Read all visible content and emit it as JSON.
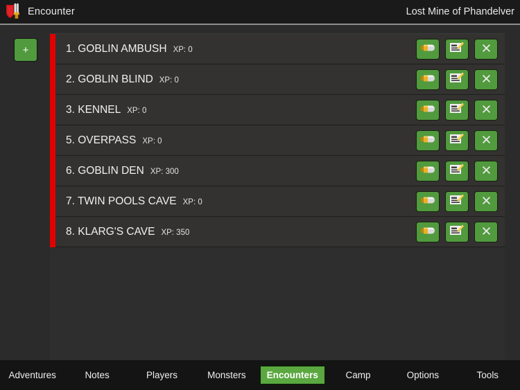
{
  "titlebar": {
    "icon": "shield-sword-icon",
    "app_title": "Encounter",
    "adventure_title": "Lost Mine of Phandelver"
  },
  "toolbar": {
    "add_label": "+",
    "add_icon": "plus-icon"
  },
  "encounters": {
    "xp_prefix": "XP: ",
    "rows": [
      {
        "name": "1. GOBLIN AMBUSH",
        "xp": "XP: 0"
      },
      {
        "name": "2. GOBLIN BLIND",
        "xp": "XP: 0"
      },
      {
        "name": "3. KENNEL",
        "xp": "XP: 0"
      },
      {
        "name": "5. OVERPASS",
        "xp": "XP: 0"
      },
      {
        "name": "6. GOBLIN DEN",
        "xp": "XP: 300"
      },
      {
        "name": "7. TWIN POOLS CAVE",
        "xp": "XP: 0"
      },
      {
        "name": "8. KLARG'S CAVE",
        "xp": "XP: 350"
      }
    ],
    "actions": {
      "run_icon": "bullet-icon",
      "edit_icon": "note-edit-icon",
      "delete_label": "X",
      "delete_icon": "close-x-icon"
    }
  },
  "tabs": [
    {
      "label": "Adventures",
      "active": false
    },
    {
      "label": "Notes",
      "active": false
    },
    {
      "label": "Players",
      "active": false
    },
    {
      "label": "Monsters",
      "active": false
    },
    {
      "label": "Encounters",
      "active": true
    },
    {
      "label": "Camp",
      "active": false
    },
    {
      "label": "Options",
      "active": false
    },
    {
      "label": "Tools",
      "active": false
    }
  ],
  "colors": {
    "accent_green": "#519a3e",
    "active_tab_green": "#5aa83f",
    "row_marker_red": "#e00000",
    "titlebar_bg": "#1a1a1a",
    "panel_bg": "#2e2e2e",
    "row_bg": "#333230",
    "app_bg": "#2b2b2b",
    "tabbar_bg": "#141414"
  }
}
